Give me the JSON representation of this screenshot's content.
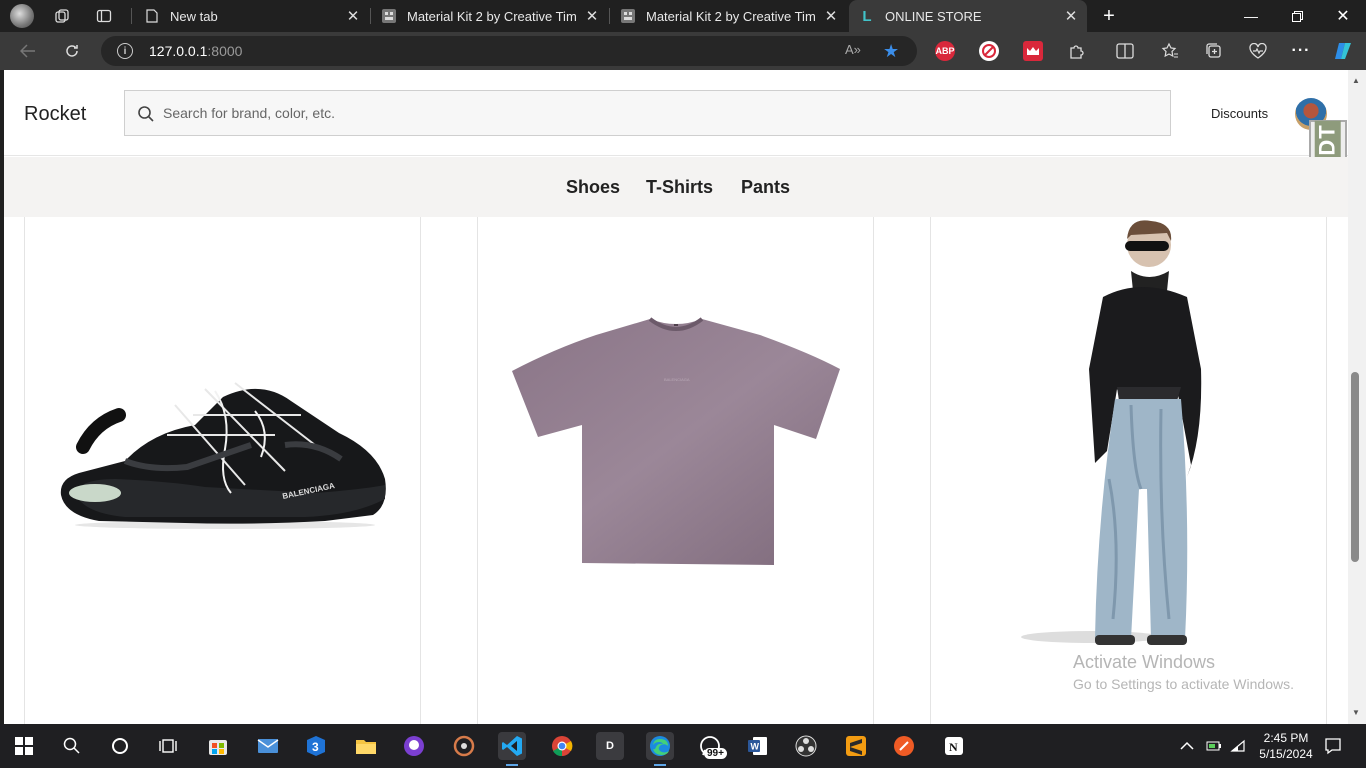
{
  "browser": {
    "tabs": [
      {
        "title": "New tab"
      },
      {
        "title": "Material Kit 2 by Creative Tim"
      },
      {
        "title": "Material Kit 2 by Creative Tim"
      },
      {
        "title": "ONLINE STORE"
      }
    ],
    "address": {
      "host": "127.0.0.1",
      "port": ":8000"
    },
    "read_aloud": "A»"
  },
  "site": {
    "brand": "Rocket",
    "search": {
      "placeholder": "Search for brand, color, etc.",
      "value": ""
    },
    "discounts_label": "Discounts",
    "debug_toolbar": "DJDT",
    "categories": [
      "Shoes",
      "T-Shirts",
      "Pants"
    ],
    "products": [
      {
        "image": "black-sneaker",
        "brand_print": "BALENCIAGA"
      },
      {
        "image": "purple-tshirt"
      },
      {
        "image": "model-wide-pants"
      }
    ]
  },
  "watermark": {
    "line1": "Activate Windows",
    "line2": "Go to Settings to activate Windows."
  },
  "taskbar": {
    "badge": "99+",
    "time": "2:45 PM",
    "date": "5/15/2024"
  },
  "colors": {
    "accent_blue": "#3b8eea",
    "tshirt": "#8f7b8c",
    "nav_bg": "#f4f3f2"
  }
}
